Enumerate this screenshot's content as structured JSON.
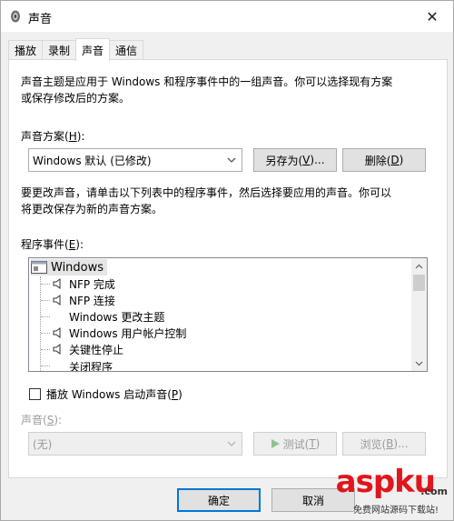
{
  "window": {
    "title": "声音",
    "close_glyph": "✕"
  },
  "tabs": [
    {
      "label": "播放"
    },
    {
      "label": "录制"
    },
    {
      "label": "声音",
      "active": true
    },
    {
      "label": "通信"
    }
  ],
  "sounds_tab": {
    "intro_line1": "声音主题是应用于 Windows 和程序事件中的一组声音。你可以选择现有方案",
    "intro_line2": "或保存修改后的方案。",
    "scheme_label": "声音方案(",
    "scheme_key": "H",
    "scheme_label_end": "):",
    "scheme_value": "Windows 默认 (已修改)",
    "save_as_label": "另存为(",
    "save_as_key": "V",
    "save_as_end": ")...",
    "delete_label": "删除(",
    "delete_key": "D",
    "delete_end": ")",
    "change_line1": "要更改声音，请单击以下列表中的程序事件，然后选择要应用的声音。你可以",
    "change_line2": "将更改保存为新的声音方案。",
    "events_label": "程序事件(",
    "events_key": "E",
    "events_end": "):",
    "events": {
      "root": "Windows",
      "items": [
        {
          "label": "NFP 完成",
          "has_sound": true
        },
        {
          "label": "NFP 连接",
          "has_sound": true
        },
        {
          "label": "Windows 更改主题",
          "has_sound": false
        },
        {
          "label": "Windows 用户帐户控制",
          "has_sound": true
        },
        {
          "label": "关键性停止",
          "has_sound": true
        },
        {
          "label": "关闭程序",
          "has_sound": false
        }
      ]
    },
    "startup_sound_label": "播放 Windows 启动声音(",
    "startup_sound_key": "P",
    "startup_sound_end": ")",
    "startup_sound_checked": false,
    "sound_label": "声音(",
    "sound_key": "S",
    "sound_end": "):",
    "sound_value": "(无)",
    "test_label": "测试(",
    "test_key": "T",
    "test_end": ")",
    "browse_label": "浏览(",
    "browse_key": "B",
    "browse_end": ")..."
  },
  "footer": {
    "ok_label": "确定",
    "cancel_label": "取消"
  },
  "watermark": {
    "brand": "aspku",
    "suffix": ".com",
    "tagline": "免费网站源码下载站!"
  },
  "colors": {
    "accent": "#0078d7",
    "watermark_red": "#e0161c"
  }
}
